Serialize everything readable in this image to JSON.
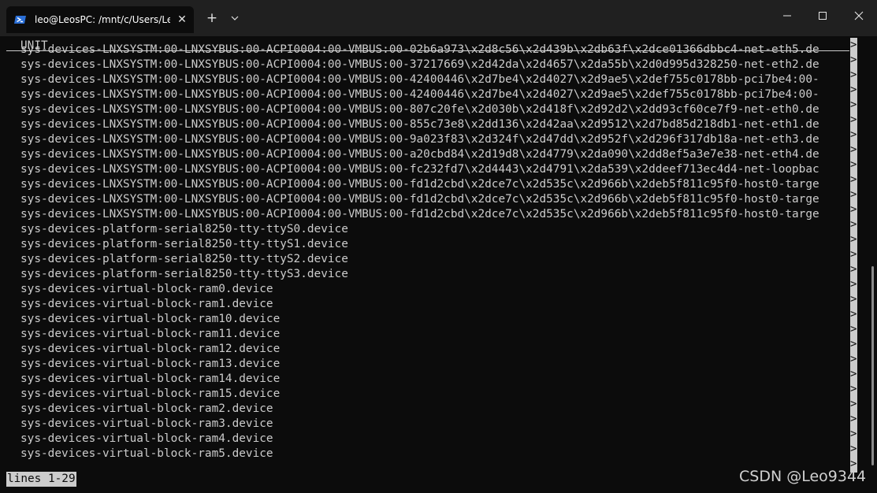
{
  "window": {
    "tab_title": "leo@LeosPC: /mnt/c/Users/Le",
    "tab_icon": "powershell-icon",
    "close_tab_glyph": "✕",
    "new_tab_glyph": "+",
    "dropdown_glyph": "⌵",
    "minimize_glyph": "—",
    "maximize_glyph": "☐",
    "close_glyph": "✕"
  },
  "terminal": {
    "header": "UNIT",
    "lines": [
      "sys-devices-LNXSYSTM:00-LNXSYBUS:00-ACPI0004:00-VMBUS:00-02b6a973\\x2d8c56\\x2d439b\\x2db63f\\x2dce01366dbbc4-net-eth5.de",
      "sys-devices-LNXSYSTM:00-LNXSYBUS:00-ACPI0004:00-VMBUS:00-37217669\\x2d42da\\x2d4657\\x2da55b\\x2d0d995d328250-net-eth2.de",
      "sys-devices-LNXSYSTM:00-LNXSYBUS:00-ACPI0004:00-VMBUS:00-42400446\\x2d7be4\\x2d4027\\x2d9ae5\\x2def755c0178bb-pci7be4:00-",
      "sys-devices-LNXSYSTM:00-LNXSYBUS:00-ACPI0004:00-VMBUS:00-42400446\\x2d7be4\\x2d4027\\x2d9ae5\\x2def755c0178bb-pci7be4:00-",
      "sys-devices-LNXSYSTM:00-LNXSYBUS:00-ACPI0004:00-VMBUS:00-807c20fe\\x2d030b\\x2d418f\\x2d92d2\\x2dd93cf60ce7f9-net-eth0.de",
      "sys-devices-LNXSYSTM:00-LNXSYBUS:00-ACPI0004:00-VMBUS:00-855c73e8\\x2dd136\\x2d42aa\\x2d9512\\x2d7bd85d218db1-net-eth1.de",
      "sys-devices-LNXSYSTM:00-LNXSYBUS:00-ACPI0004:00-VMBUS:00-9a023f83\\x2d324f\\x2d47dd\\x2d952f\\x2d296f317db18a-net-eth3.de",
      "sys-devices-LNXSYSTM:00-LNXSYBUS:00-ACPI0004:00-VMBUS:00-a20cbd84\\x2d19d8\\x2d4779\\x2da090\\x2dd8ef5a3e7e38-net-eth4.de",
      "sys-devices-LNXSYSTM:00-LNXSYBUS:00-ACPI0004:00-VMBUS:00-fc232fd7\\x2d4443\\x2d4791\\x2da539\\x2ddeef713ec4d4-net-loopbac",
      "sys-devices-LNXSYSTM:00-LNXSYBUS:00-ACPI0004:00-VMBUS:00-fd1d2cbd\\x2dce7c\\x2d535c\\x2d966b\\x2deb5f811c95f0-host0-targe",
      "sys-devices-LNXSYSTM:00-LNXSYBUS:00-ACPI0004:00-VMBUS:00-fd1d2cbd\\x2dce7c\\x2d535c\\x2d966b\\x2deb5f811c95f0-host0-targe",
      "sys-devices-LNXSYSTM:00-LNXSYBUS:00-ACPI0004:00-VMBUS:00-fd1d2cbd\\x2dce7c\\x2d535c\\x2d966b\\x2deb5f811c95f0-host0-targe",
      "sys-devices-platform-serial8250-tty-ttyS0.device",
      "sys-devices-platform-serial8250-tty-ttyS1.device",
      "sys-devices-platform-serial8250-tty-ttyS2.device",
      "sys-devices-platform-serial8250-tty-ttyS3.device",
      "sys-devices-virtual-block-ram0.device",
      "sys-devices-virtual-block-ram1.device",
      "sys-devices-virtual-block-ram10.device",
      "sys-devices-virtual-block-ram11.device",
      "sys-devices-virtual-block-ram12.device",
      "sys-devices-virtual-block-ram13.device",
      "sys-devices-virtual-block-ram14.device",
      "sys-devices-virtual-block-ram15.device",
      "sys-devices-virtual-block-ram2.device",
      "sys-devices-virtual-block-ram3.device",
      "sys-devices-virtual-block-ram4.device",
      "sys-devices-virtual-block-ram5.device"
    ],
    "truncation_marker": ">",
    "status": "lines 1-29"
  },
  "watermark": "CSDN @Leo9344"
}
